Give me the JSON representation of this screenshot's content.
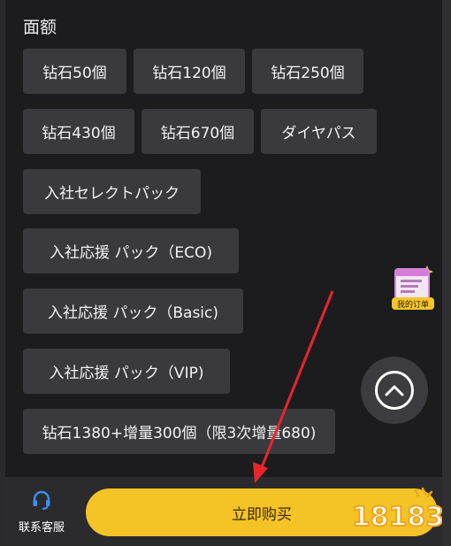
{
  "section_title": "面额",
  "options": [
    "钻石50個",
    "钻石120個",
    "钻石250個",
    "钻石430個",
    "钻石670個",
    "ダイヤパス",
    "入社セレクトパック",
    "入社応援 パック（ECO)",
    "入社応援 パック（Basic)",
    "入社応援 パック（VIP)",
    "钻石1380+增量300個（限3次增量680)"
  ],
  "floating_order_label": "我的订单",
  "customer_service_label": "联系客服",
  "buy_button_label": "立即购买",
  "watermark_text": "18183",
  "colors": {
    "background": "#1c1c1e",
    "option_bg": "#3a3a3e",
    "buy_button": "#f4c326",
    "arrow": "#e8262b",
    "service_icon": "#3b8ff0"
  }
}
